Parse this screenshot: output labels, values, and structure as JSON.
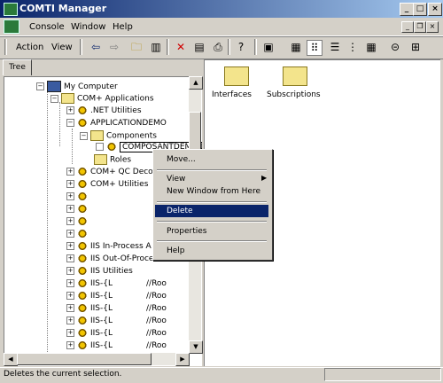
{
  "window": {
    "title": "COMTI Manager"
  },
  "menu": {
    "items": [
      "Console",
      "Window",
      "Help"
    ]
  },
  "toolbar": {
    "action_label": "Action",
    "view_label": "View"
  },
  "left_tab": {
    "label": "Tree"
  },
  "tree": {
    "my_computer": "My Computer",
    "com_apps": "COM+ Applications",
    "net_utilities": ".NET Utilities",
    "appdemo": "APPLICATIONDEMO",
    "components": "Components",
    "component_selected": "COMPOSANTDEMO.DEMO.1",
    "roles": "Roles",
    "qc": "COM+ QC Deco",
    "com_utilities": "COM+ Utilities",
    "iis_inprocess": "IIS In-Process A",
    "iis_outofprocess": "IIS Out-Of-Process Pool",
    "iis_utilities": "IIS Utilities",
    "iis_items": [
      "IIS-{L",
      "IIS-{L",
      "IIS-{L",
      "IIS-{L",
      "IIS-{L",
      "IIS-{L"
    ],
    "iis_suffix": "//Roo"
  },
  "right_pane": {
    "items": [
      "Interfaces",
      "Subscriptions"
    ]
  },
  "context_menu": {
    "items": [
      "Move...",
      "View",
      "New Window from Here",
      "Delete",
      "Properties",
      "Help"
    ],
    "highlighted": "Delete"
  },
  "status_bar": {
    "text": "Deletes the current selection."
  },
  "colors": {
    "selection": "#0a246a",
    "titlebar_start": "#0a246a",
    "titlebar_end": "#a6caf0"
  }
}
